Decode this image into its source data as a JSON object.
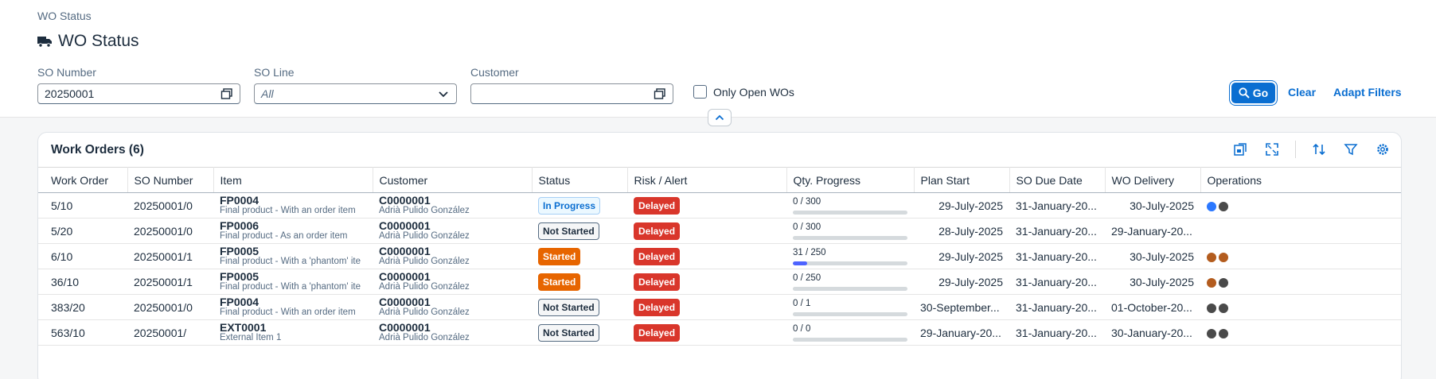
{
  "breadcrumb": "WO Status",
  "title": "WO Status",
  "filters": {
    "so_number": {
      "label": "SO Number",
      "value": "20250001"
    },
    "so_line": {
      "label": "SO Line",
      "placeholder": "All"
    },
    "customer": {
      "label": "Customer",
      "value": ""
    },
    "only_open": {
      "label": "Only Open WOs",
      "checked": false
    },
    "go_label": "Go",
    "clear_label": "Clear",
    "adapt_label": "Adapt Filters"
  },
  "table": {
    "title": "Work Orders (6)",
    "columns": [
      "Work Order",
      "SO Number",
      "Item",
      "Customer",
      "Status",
      "Risk / Alert",
      "Qty. Progress",
      "Plan Start",
      "SO Due Date",
      "WO Delivery",
      "Operations"
    ],
    "rows": [
      {
        "work_order": "5/10",
        "so_number": "20250001/0",
        "item_code": "FP0004",
        "item_desc": "Final product - With an order item",
        "customer_code": "C0000001",
        "customer_name": "Adrià Pulido González",
        "status": "In Progress",
        "status_kind": "progress",
        "risk": "Delayed",
        "qty_text": "0 / 300",
        "qty_done": 0,
        "qty_total": 300,
        "plan_start": "29-July-2025",
        "so_due": "31-January-20...",
        "wo_delivery": "30-July-2025",
        "delivery_align": "right",
        "ops": [
          "#2b78ff",
          "#4a4a4a"
        ]
      },
      {
        "work_order": "5/20",
        "so_number": "20250001/0",
        "item_code": "FP0006",
        "item_desc": "Final product - As an order item",
        "customer_code": "C0000001",
        "customer_name": "Adrià Pulido González",
        "status": "Not Started",
        "status_kind": "notstarted",
        "risk": "Delayed",
        "qty_text": "0 / 300",
        "qty_done": 0,
        "qty_total": 300,
        "plan_start": "28-July-2025",
        "so_due": "31-January-20...",
        "wo_delivery": "29-January-20...",
        "delivery_align": "left",
        "ops": []
      },
      {
        "work_order": "6/10",
        "so_number": "20250001/1",
        "item_code": "FP0005",
        "item_desc": "Final product - With a 'phantom' ite",
        "customer_code": "C0000001",
        "customer_name": "Adrià Pulido González",
        "status": "Started",
        "status_kind": "started",
        "risk": "Delayed",
        "qty_text": "31 / 250",
        "qty_done": 31,
        "qty_total": 250,
        "plan_start": "29-July-2025",
        "so_due": "31-January-20...",
        "wo_delivery": "30-July-2025",
        "delivery_align": "right",
        "ops": [
          "#b35c1e",
          "#b35c1e"
        ]
      },
      {
        "work_order": "36/10",
        "so_number": "20250001/1",
        "item_code": "FP0005",
        "item_desc": "Final product - With a 'phantom' ite",
        "customer_code": "C0000001",
        "customer_name": "Adrià Pulido González",
        "status": "Started",
        "status_kind": "started",
        "risk": "Delayed",
        "qty_text": "0 / 250",
        "qty_done": 0,
        "qty_total": 250,
        "plan_start": "29-July-2025",
        "so_due": "31-January-20...",
        "wo_delivery": "30-July-2025",
        "delivery_align": "right",
        "ops": [
          "#b35c1e",
          "#4a4a4a"
        ]
      },
      {
        "work_order": "383/20",
        "so_number": "20250001/0",
        "item_code": "FP0004",
        "item_desc": "Final product - With an order item",
        "customer_code": "C0000001",
        "customer_name": "Adrià Pulido González",
        "status": "Not Started",
        "status_kind": "notstarted",
        "risk": "Delayed",
        "qty_text": "0 / 1",
        "qty_done": 0,
        "qty_total": 1,
        "plan_start": "30-September...",
        "so_due": "31-January-20...",
        "wo_delivery": "01-October-20...",
        "delivery_align": "left",
        "ops": [
          "#4a4a4a",
          "#4a4a4a"
        ]
      },
      {
        "work_order": "563/10",
        "so_number": "20250001/",
        "item_code": "EXT0001",
        "item_desc": "External Item 1",
        "customer_code": "C0000001",
        "customer_name": "Adrià Pulido González",
        "status": "Not Started",
        "status_kind": "notstarted",
        "risk": "Delayed",
        "qty_text": "0 / 0",
        "qty_done": 0,
        "qty_total": 0,
        "plan_start": "29-January-20...",
        "so_due": "31-January-20...",
        "wo_delivery": "30-January-20...",
        "delivery_align": "left",
        "ops": [
          "#4a4a4a",
          "#4a4a4a"
        ]
      }
    ]
  },
  "colors": {
    "accent": "#0a6ed1",
    "delayed": "#d9362b",
    "started": "#e76500",
    "progress_fill": "#4d63ff"
  },
  "icons": {
    "title": "truck-icon",
    "value_help": "value-help-icon",
    "dropdown": "chevron-down-icon",
    "collapse": "chevron-up-icon",
    "go": "search-icon"
  }
}
